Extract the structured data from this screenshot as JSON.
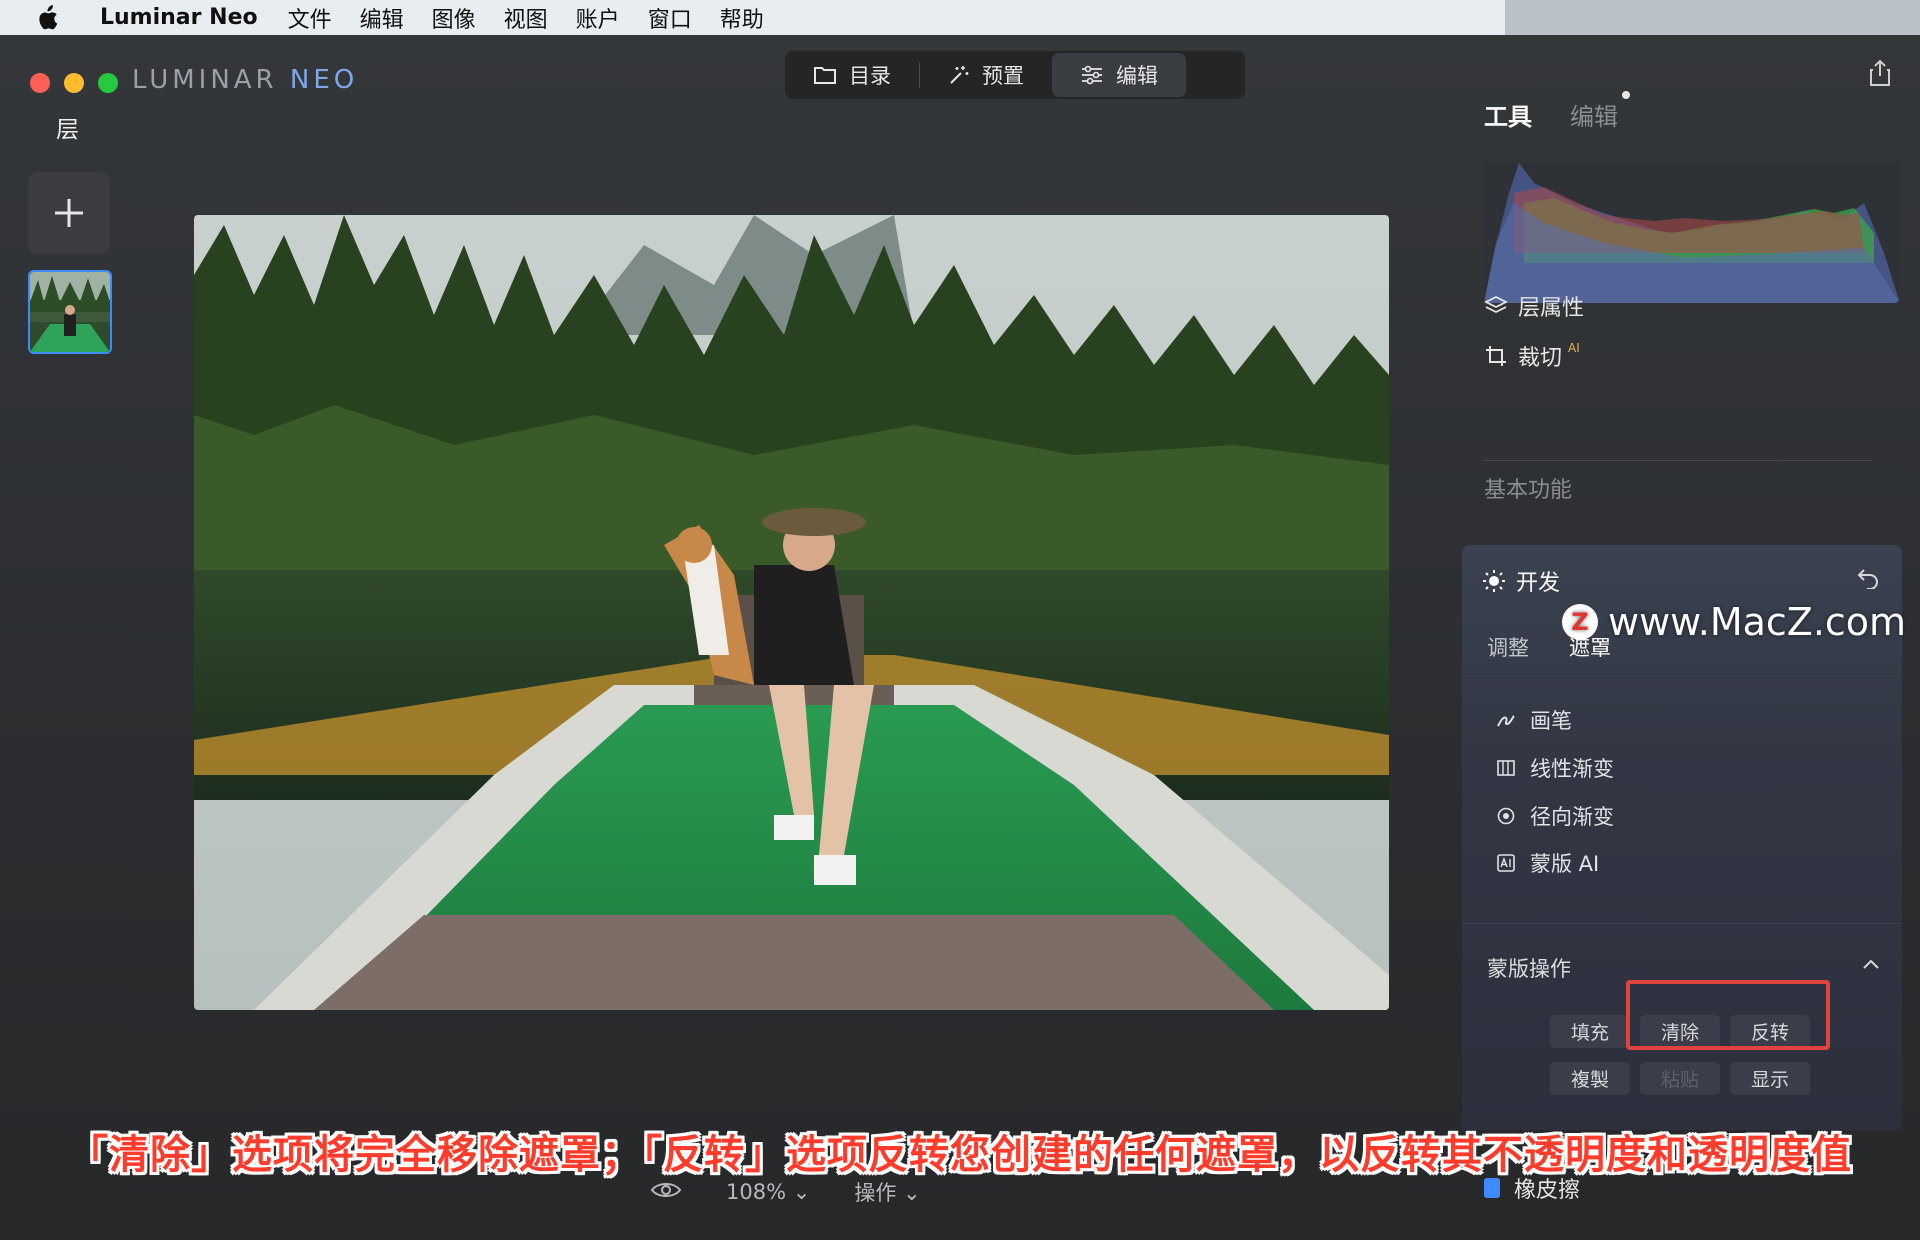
{
  "menubar": {
    "app_name": "Luminar Neo",
    "items": [
      "文件",
      "编辑",
      "图像",
      "视图",
      "账户",
      "窗口",
      "帮助"
    ]
  },
  "window": {
    "logo_left": "LUMINAR",
    "logo_right": "NEO",
    "modes": [
      {
        "label": "目录",
        "icon": "folder-icon"
      },
      {
        "label": "预置",
        "icon": "magic-wand-icon"
      },
      {
        "label": "编辑",
        "icon": "sliders-icon"
      }
    ],
    "active_mode": "编辑"
  },
  "layers": {
    "title": "层"
  },
  "canvas": {
    "zoom": "108%",
    "actions_label": "操作"
  },
  "right_panel": {
    "tabs": {
      "tools": "工具",
      "edit": "编辑"
    },
    "layer_properties": "层属性",
    "crop": "裁切",
    "crop_badge": "AI",
    "basic": "基本功能",
    "develop": {
      "title": "开发",
      "subtabs": [
        "调整",
        "遮罩"
      ],
      "active_subtab": "遮罩",
      "mask_tools": [
        {
          "label": "画笔",
          "icon": "brush-icon"
        },
        {
          "label": "线性渐变",
          "icon": "linear-gradient-icon"
        },
        {
          "label": "径向渐变",
          "icon": "radial-gradient-icon"
        },
        {
          "label": "蒙版 AI",
          "icon": "mask-ai-icon"
        }
      ],
      "mask_ops_title": "蒙版操作",
      "ops": {
        "fill": "填充",
        "clear": "清除",
        "invert": "反转",
        "copy": "複製",
        "paste": "粘贴",
        "show": "显示"
      }
    },
    "eraser": "橡皮擦"
  },
  "watermark": {
    "logo_letter": "Z",
    "text": "www.MacZ.com"
  },
  "caption": "「清除」选项将完全移除遮罩；「反转」选项反转您创建的任何遮罩，以反转其不透明度和透明度值",
  "colors": {
    "accent_blue": "#3d8bff",
    "highlight_red": "#e0433e",
    "caption_red": "#ff3b2b"
  }
}
